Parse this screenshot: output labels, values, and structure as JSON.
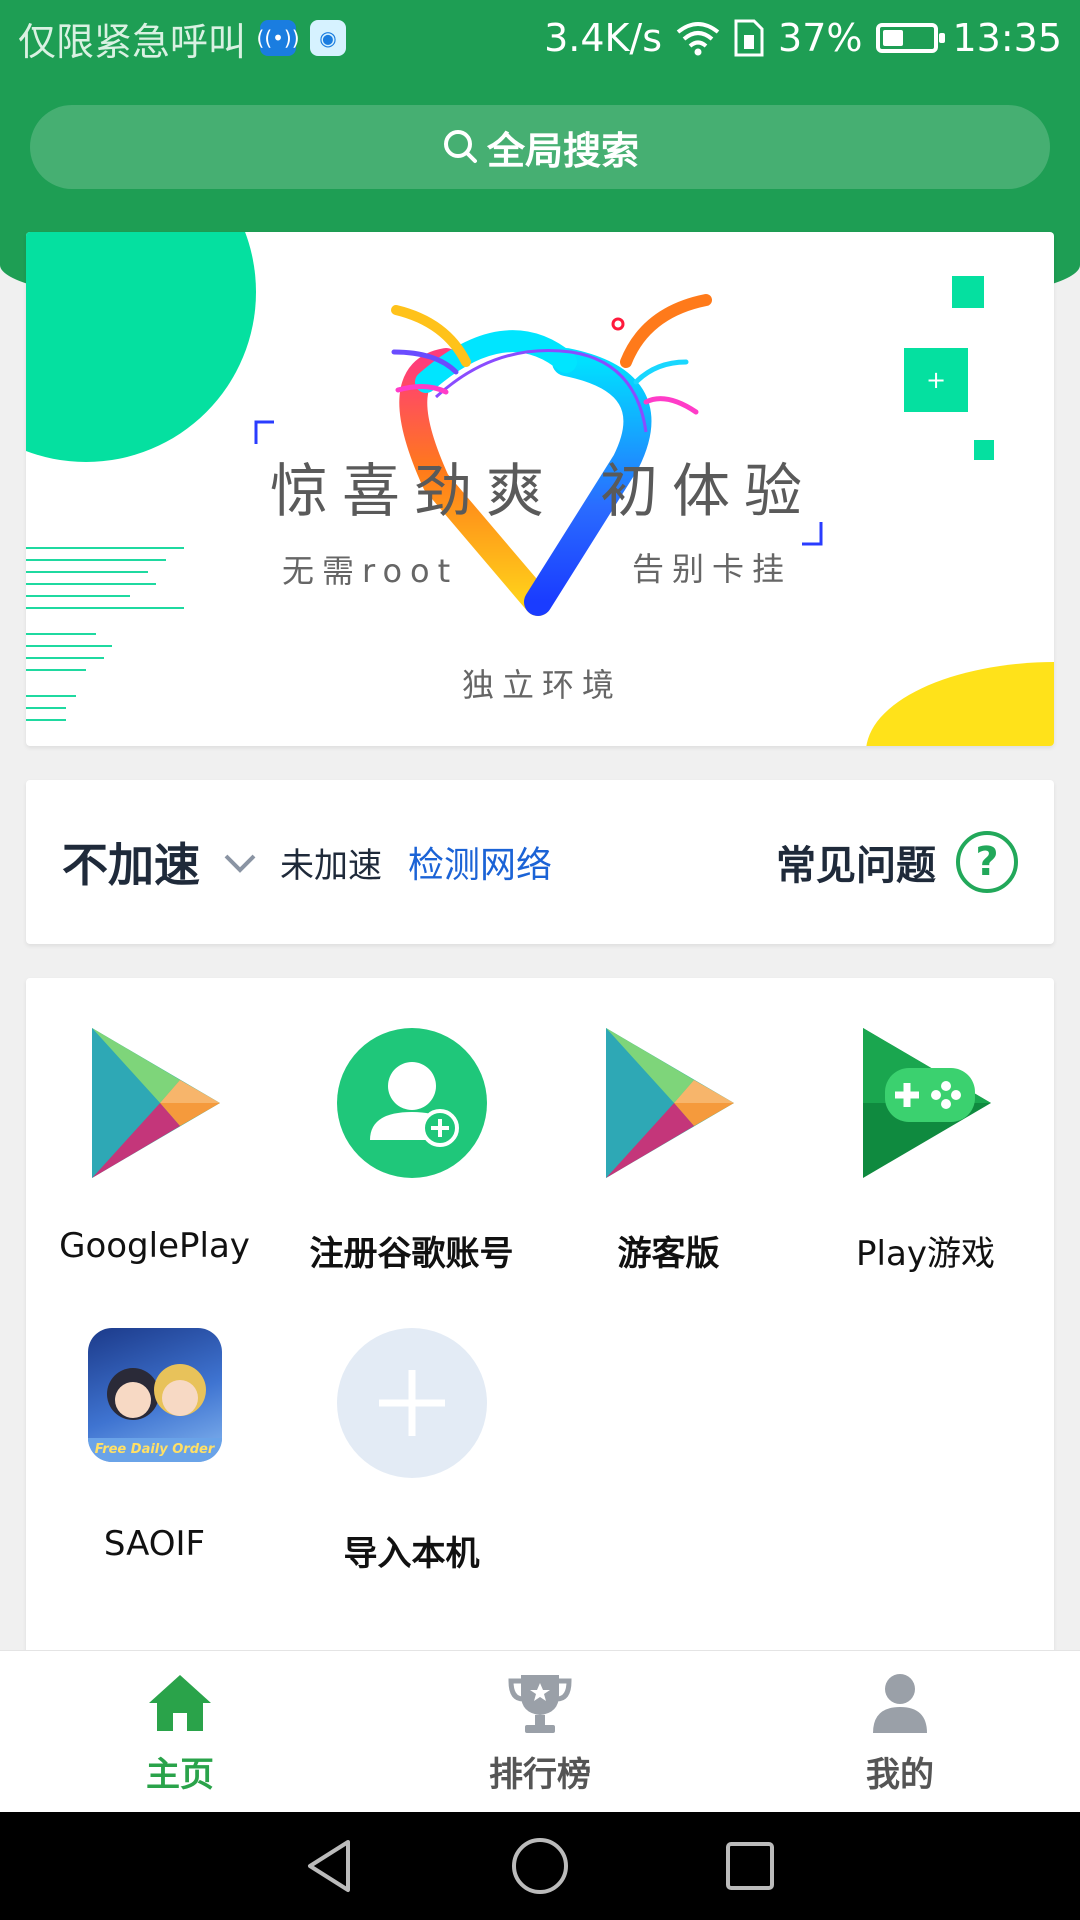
{
  "status_bar": {
    "carrier": "仅限紧急呼叫",
    "speed": "3.4K/s",
    "battery_percent": "37%",
    "time": "13:35"
  },
  "search": {
    "label": "全局搜索"
  },
  "banner": {
    "title_left": "惊喜劲爽",
    "title_right": "初体验",
    "sub_left": "无需root",
    "sub_right": "告别卡挂",
    "sub_bottom": "独立环境"
  },
  "accel": {
    "mode": "不加速",
    "status": "未加速",
    "detect": "检测网络",
    "faq": "常见问题",
    "help_glyph": "?"
  },
  "apps": [
    {
      "label": "GooglePlay",
      "icon": "google-play-icon"
    },
    {
      "label": "注册谷歌账号",
      "icon": "add-account-icon"
    },
    {
      "label": "游客版",
      "icon": "google-play-icon"
    },
    {
      "label": "Play游戏",
      "icon": "play-games-icon"
    },
    {
      "label": "SAOIF",
      "icon": "saoif-app-icon",
      "icon_text": "Free Daily Order"
    },
    {
      "label": "导入本机",
      "icon": "add-icon"
    }
  ],
  "nav": [
    {
      "label": "主页",
      "icon": "home-icon",
      "active": true
    },
    {
      "label": "排行榜",
      "icon": "trophy-icon",
      "active": false
    },
    {
      "label": "我的",
      "icon": "person-icon",
      "active": false
    }
  ],
  "colors": {
    "header_green": "#1e9e54",
    "accent_green": "#2aa34a",
    "link_blue": "#1b63d6"
  }
}
